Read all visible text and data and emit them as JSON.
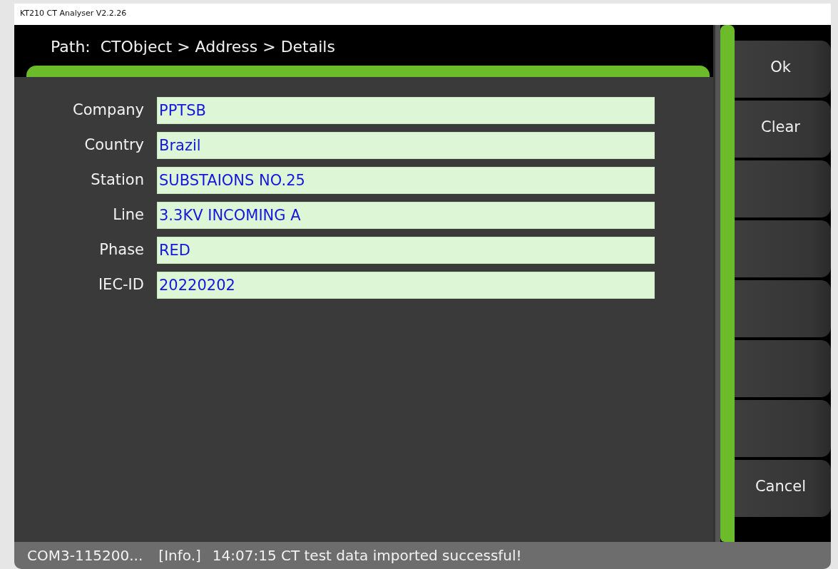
{
  "window": {
    "title": "KT210 CT Analyser V2.2.26"
  },
  "path": {
    "label": "Path:",
    "crumbs": "CTObject > Address > Details"
  },
  "fields": [
    {
      "label": "Company",
      "value": "PPTSB"
    },
    {
      "label": "Country",
      "value": "Brazil"
    },
    {
      "label": "Station",
      "value": "SUBSTAIONS NO.25"
    },
    {
      "label": "Line",
      "value": "3.3KV INCOMING A"
    },
    {
      "label": "Phase",
      "value": "RED"
    },
    {
      "label": "IEC-ID",
      "value": "20220202"
    }
  ],
  "buttons": [
    {
      "kind": "labeled",
      "label": "Ok"
    },
    {
      "kind": "labeled",
      "label": "Clear"
    },
    {
      "kind": "blank"
    },
    {
      "kind": "blank"
    },
    {
      "kind": "blank"
    },
    {
      "kind": "blank"
    },
    {
      "kind": "blank"
    },
    {
      "kind": "labeled",
      "label": "Cancel"
    }
  ],
  "status_bar": {
    "port": "COM3-115200...",
    "level": "[Info.]",
    "message": "14:07:15 CT test data imported successful!"
  }
}
